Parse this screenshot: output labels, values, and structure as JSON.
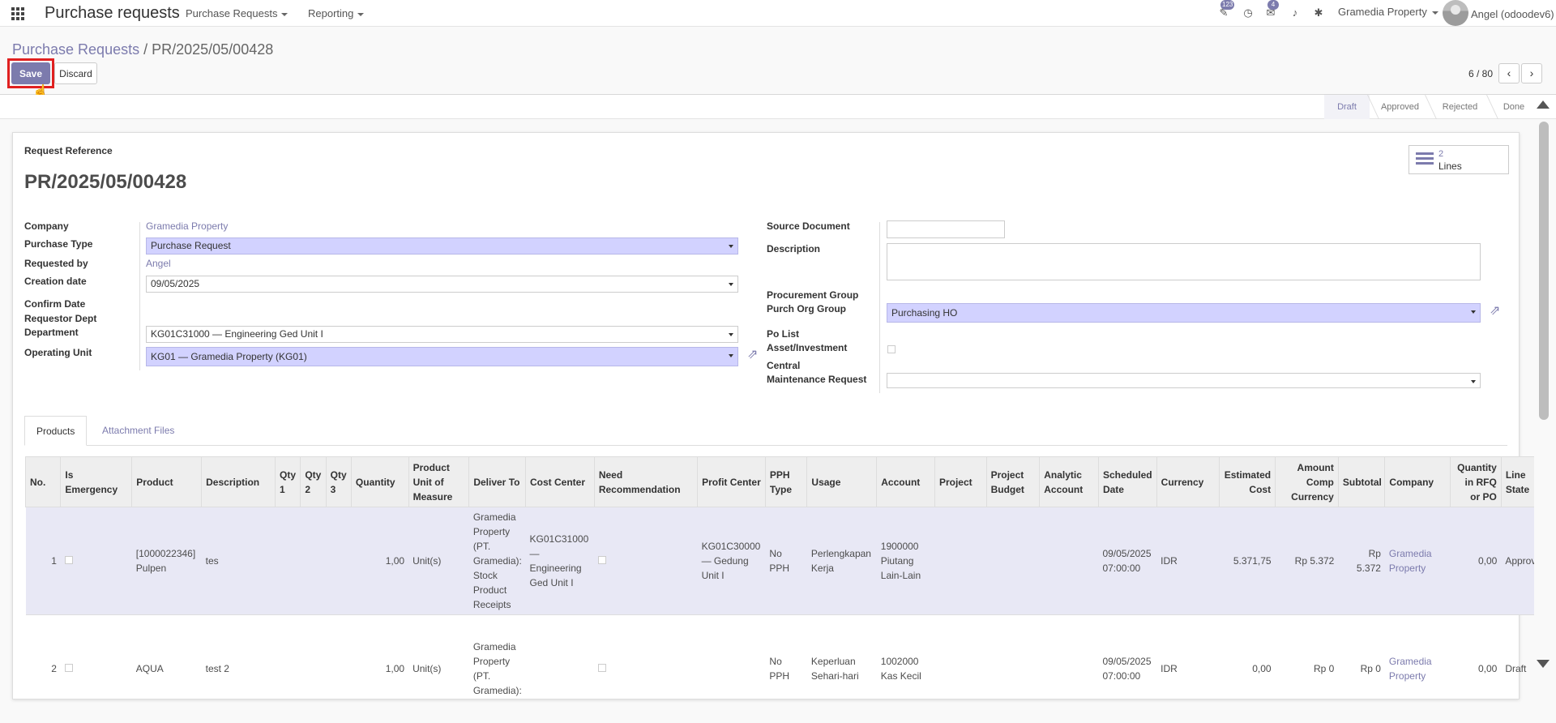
{
  "topbar": {
    "app_title": "Purchase requests",
    "menus": [
      "Purchase Requests",
      "Reporting"
    ],
    "badge_activity": "123",
    "badge_chat": "4",
    "company": "Gramedia Property",
    "user": "Angel (odoodev6)"
  },
  "breadcrumb": {
    "parent": "Purchase Requests",
    "separator": "/",
    "current": "PR/2025/05/00428"
  },
  "buttons": {
    "save": "Save",
    "discard": "Discard"
  },
  "pager": {
    "text": "6 / 80",
    "prev": "‹",
    "next": "›"
  },
  "stages": [
    "Draft",
    "Approved",
    "Rejected",
    "Done"
  ],
  "stat_button": {
    "value": "2",
    "label": "Lines"
  },
  "form": {
    "ref_label": "Request Reference",
    "ref_value": "PR/2025/05/00428",
    "company_label": "Company",
    "company": "Gramedia Property",
    "purchase_type_label": "Purchase Type",
    "purchase_type": "Purchase Request",
    "requested_by_label": "Requested by",
    "requested_by": "Angel",
    "creation_date_label": "Creation date",
    "creation_date": "09/05/2025",
    "confirm_date_label": "Confirm Date",
    "req_dept_label": "Requestor Dept",
    "department_label": "Department",
    "department": "KG01C31000 — Engineering Ged Unit I",
    "operating_unit_label": "Operating Unit",
    "operating_unit": "KG01 — Gramedia Property (KG01)",
    "source_doc_label": "Source Document",
    "description_label": "Description",
    "proc_group_label": "Procurement Group",
    "purch_org_label": "Purch Org Group",
    "purch_org": "Purchasing HO",
    "po_list_label": "Po List",
    "asset_label": "Asset/Investment",
    "central_label": "Central",
    "maint_label": "Maintenance Request"
  },
  "tabs": [
    "Products",
    "Attachment Files"
  ],
  "table": {
    "headers": [
      "No.",
      "Is Emergency",
      "Product",
      "Description",
      "Qty 1",
      "Qty 2",
      "Qty 3",
      "Quantity",
      "Product Unit of Measure",
      "Deliver To",
      "Cost Center",
      "Need Recommendation",
      "Profit Center",
      "PPH Type",
      "Usage",
      "Account",
      "Project",
      "Project Budget",
      "Analytic Account",
      "Scheduled Date",
      "Currency",
      "Estimated Cost",
      "Amount Comp Currency",
      "Subtotal",
      "Company",
      "Quantity in RFQ or PO",
      "Line State"
    ],
    "rows": [
      {
        "no": "1",
        "product": "[1000022346] Pulpen",
        "description": "tes",
        "quantity": "1,00",
        "uom": "Unit(s)",
        "deliver_to": "Gramedia Property (PT. Gramedia): Stock Product Receipts",
        "cost_center": "KG01C31000 — Engineering Ged Unit I",
        "profit_center": "KG01C30000 — Gedung Unit I",
        "pph": "No PPH",
        "usage": "Perlengkapan Kerja",
        "account": "1900000 Piutang Lain-Lain",
        "scheduled": "09/05/2025 07:00:00",
        "currency": "IDR",
        "est_cost": "5.371,75",
        "amount_comp": "Rp 5.372",
        "subtotal": "Rp 5.372",
        "company": "Gramedia Property",
        "qty_rfq": "0,00",
        "state": "Approved"
      },
      {
        "no": "2",
        "product": "AQUA",
        "description": "test 2",
        "quantity": "1,00",
        "uom": "Unit(s)",
        "deliver_to": "Gramedia Property (PT. Gramedia):",
        "cost_center": "",
        "profit_center": "",
        "pph": "No PPH",
        "usage": "Keperluan Sehari-hari",
        "account": "1002000 Kas Kecil",
        "scheduled": "09/05/2025 07:00:00",
        "currency": "IDR",
        "est_cost": "0,00",
        "amount_comp": "Rp 0",
        "subtotal": "Rp 0",
        "company": "Gramedia Property",
        "qty_rfq": "0,00",
        "state": "Draft"
      }
    ]
  }
}
